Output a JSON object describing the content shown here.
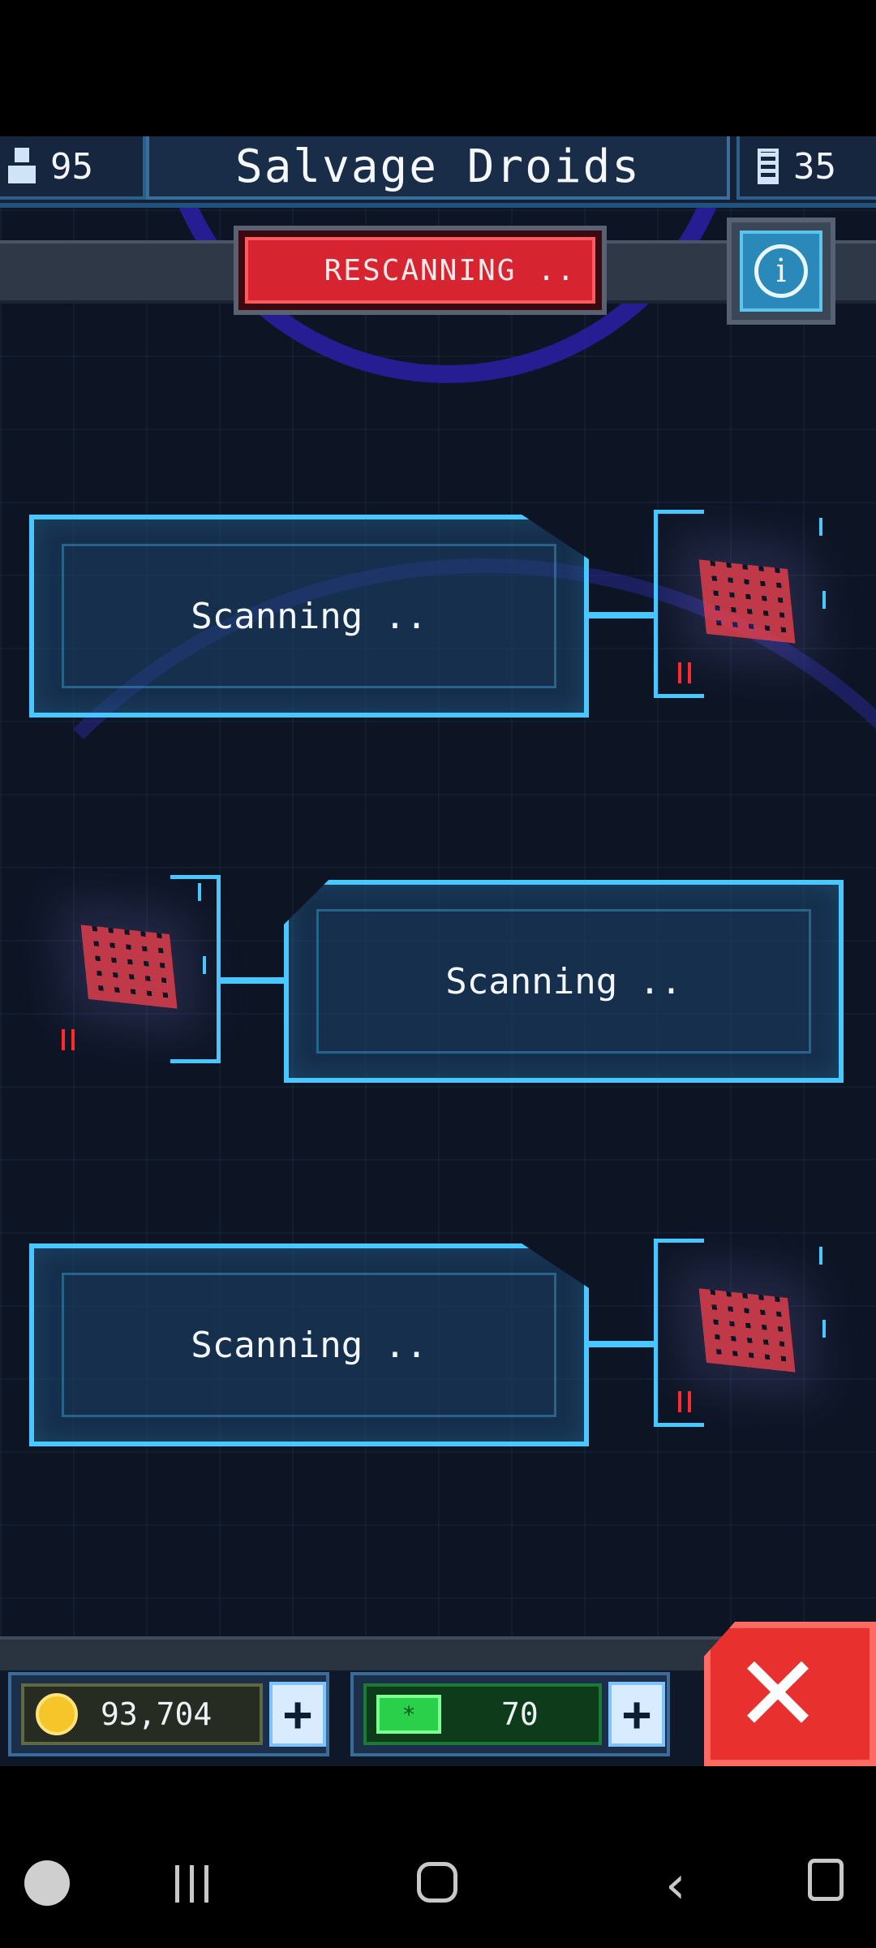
{
  "header": {
    "title": "Salvage Droids",
    "crew_count": "95",
    "droid_count": "35"
  },
  "rescan_button": {
    "label": "RESCANNING",
    "dots": ".."
  },
  "scan_slots": [
    {
      "status": "Scanning  .."
    },
    {
      "status": "Scanning  .."
    },
    {
      "status": "Scanning  .."
    }
  ],
  "resources": {
    "coins": "93,704",
    "gems": "70"
  },
  "icons": {
    "crew": "person-icon",
    "droids": "droid-stack-icon",
    "info": "info-icon",
    "coin": "coin-icon",
    "gem": "gem-icon",
    "close": "close-icon"
  },
  "colors": {
    "accent": "#49c8ff",
    "danger": "#d62430",
    "background": "#0d1424"
  }
}
